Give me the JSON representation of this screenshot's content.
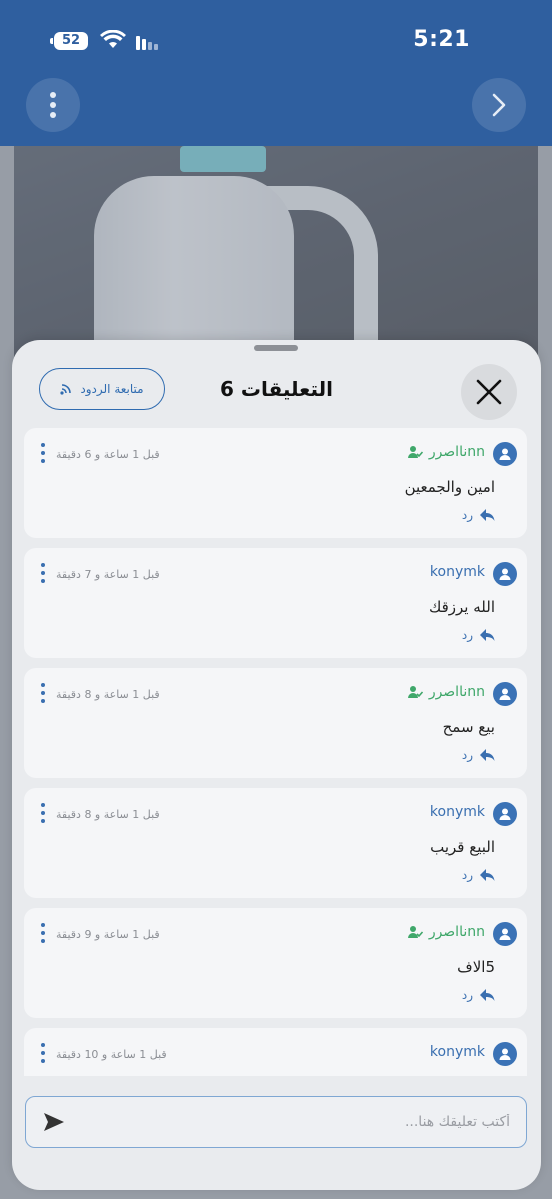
{
  "status_bar": {
    "time": "5:21",
    "battery": "52"
  },
  "header": {
    "menu_icon": "vertical-ellipsis-icon",
    "forward_icon": "chevron-right-icon"
  },
  "sheet": {
    "title": "التعليقات 6",
    "follow_label": "متابعة الردود",
    "composer_placeholder": "أكتب تعليقك هنا...",
    "comments": [
      {
        "user": "نااصررnn",
        "verified": true,
        "time": "قبل 1 ساعة و 6 دقيقة",
        "text": "امين والجمعين",
        "reply": "رد"
      },
      {
        "user": "konymk",
        "verified": false,
        "time": "قبل 1 ساعة و 7 دقيقة",
        "text": "الله يرزقك",
        "reply": "رد"
      },
      {
        "user": "نااصررnn",
        "verified": true,
        "time": "قبل 1 ساعة و 8 دقيقة",
        "text": "بيع سمح",
        "reply": "رد"
      },
      {
        "user": "konymk",
        "verified": false,
        "time": "قبل 1 ساعة و 8 دقيقة",
        "text": "البيع قريب",
        "reply": "رد"
      },
      {
        "user": "نااصررnn",
        "verified": true,
        "time": "قبل 1 ساعة و 9 دقيقة",
        "text": "5الاف",
        "reply": "رد"
      },
      {
        "user": "konymk",
        "verified": false,
        "time": "قبل 1 ساعة و 10 دقيقة",
        "text": "",
        "reply": ""
      }
    ]
  },
  "colors": {
    "header": "#2f5f9f",
    "accent": "#3a6fb0",
    "verified_user": "#3fa76a"
  }
}
